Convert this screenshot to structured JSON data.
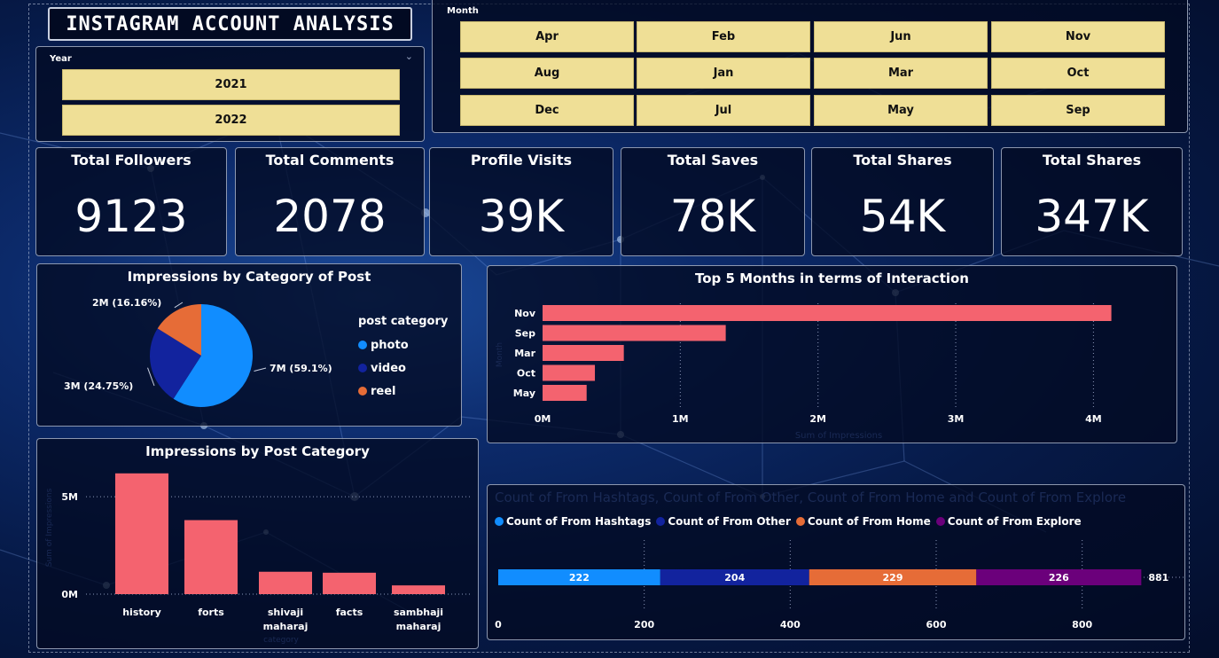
{
  "header": {
    "title": "INSTAGRAM ACCOUNT ANALYSIS"
  },
  "year_slicer": {
    "label": "Year",
    "options": [
      "2021",
      "2022"
    ],
    "chevron_icon": "chevron-down-icon"
  },
  "month_slicer": {
    "label": "Month",
    "options": [
      "Apr",
      "Feb",
      "Jun",
      "Nov",
      "Aug",
      "Jan",
      "Mar",
      "Oct",
      "Dec",
      "Jul",
      "May",
      "Sep"
    ]
  },
  "kpis": [
    {
      "title": "Total Followers",
      "value": "9123"
    },
    {
      "title": "Total Comments",
      "value": "2078"
    },
    {
      "title": "Profile Visits",
      "value": "39K"
    },
    {
      "title": "Total Saves",
      "value": "78K"
    },
    {
      "title": "Total Shares",
      "value": "54K"
    },
    {
      "title": "Total Shares",
      "value": "347K"
    }
  ],
  "colors": {
    "accent_bar": "#f4636f",
    "slicer": "#efdf96",
    "photo": "#118dff",
    "video": "#12239e",
    "reel": "#e66c37",
    "explore": "#6b007b"
  },
  "chart_data": [
    {
      "type": "pie",
      "title": "Impressions by Category of Post",
      "legend_title": "post category",
      "legend_position": "right",
      "slices": [
        {
          "name": "photo",
          "value": 59.1,
          "label": "7M (59.1%)",
          "color": "#118dff"
        },
        {
          "name": "video",
          "value": 24.75,
          "label": "3M (24.75%)",
          "color": "#12239e"
        },
        {
          "name": "reel",
          "value": 16.16,
          "label": "2M (16.16%)",
          "color": "#e66c37"
        }
      ]
    },
    {
      "type": "bar",
      "orientation": "horizontal",
      "title": "Top 5 Months in terms of Interaction",
      "xlabel": "Sum of Impressions",
      "ylabel": "Month",
      "categories": [
        "Nov",
        "Sep",
        "Mar",
        "Oct",
        "May"
      ],
      "values": [
        4130000,
        1330000,
        590000,
        380000,
        320000
      ],
      "xlim": [
        0,
        4300000
      ],
      "xticks": [
        0,
        1000000,
        2000000,
        3000000,
        4000000
      ],
      "xtick_labels": [
        "0M",
        "1M",
        "2M",
        "3M",
        "4M"
      ],
      "grid": true
    },
    {
      "type": "bar",
      "title": "Impressions by Post Category",
      "xlabel": "category",
      "ylabel": "Sum of Impressions",
      "categories": [
        "history",
        "forts",
        "shivaji maharaj",
        "facts",
        "sambhaji maharaj"
      ],
      "values": [
        6200000,
        3800000,
        1150000,
        1100000,
        450000
      ],
      "ylim": [
        0,
        6600000
      ],
      "yticks": [
        0,
        5000000
      ],
      "ytick_labels": [
        "0M",
        "5M"
      ],
      "grid": true
    },
    {
      "type": "bar",
      "orientation": "horizontal",
      "stacked": true,
      "title": "Count of From Hashtags, Count of From Other, Count of From Home and Count of From Explore",
      "legend_position": "top",
      "series": [
        {
          "name": "Count of From Hashtags",
          "values": [
            222
          ],
          "color": "#118dff"
        },
        {
          "name": "Count of From Other",
          "values": [
            204
          ],
          "color": "#12239e"
        },
        {
          "name": "Count of From Home",
          "values": [
            229
          ],
          "color": "#e66c37"
        },
        {
          "name": "Count of From Explore",
          "values": [
            226
          ],
          "color": "#6b007b"
        }
      ],
      "total_label": "881",
      "xlim": [
        0,
        900
      ],
      "xticks": [
        0,
        200,
        400,
        600,
        800
      ],
      "grid": true
    }
  ]
}
